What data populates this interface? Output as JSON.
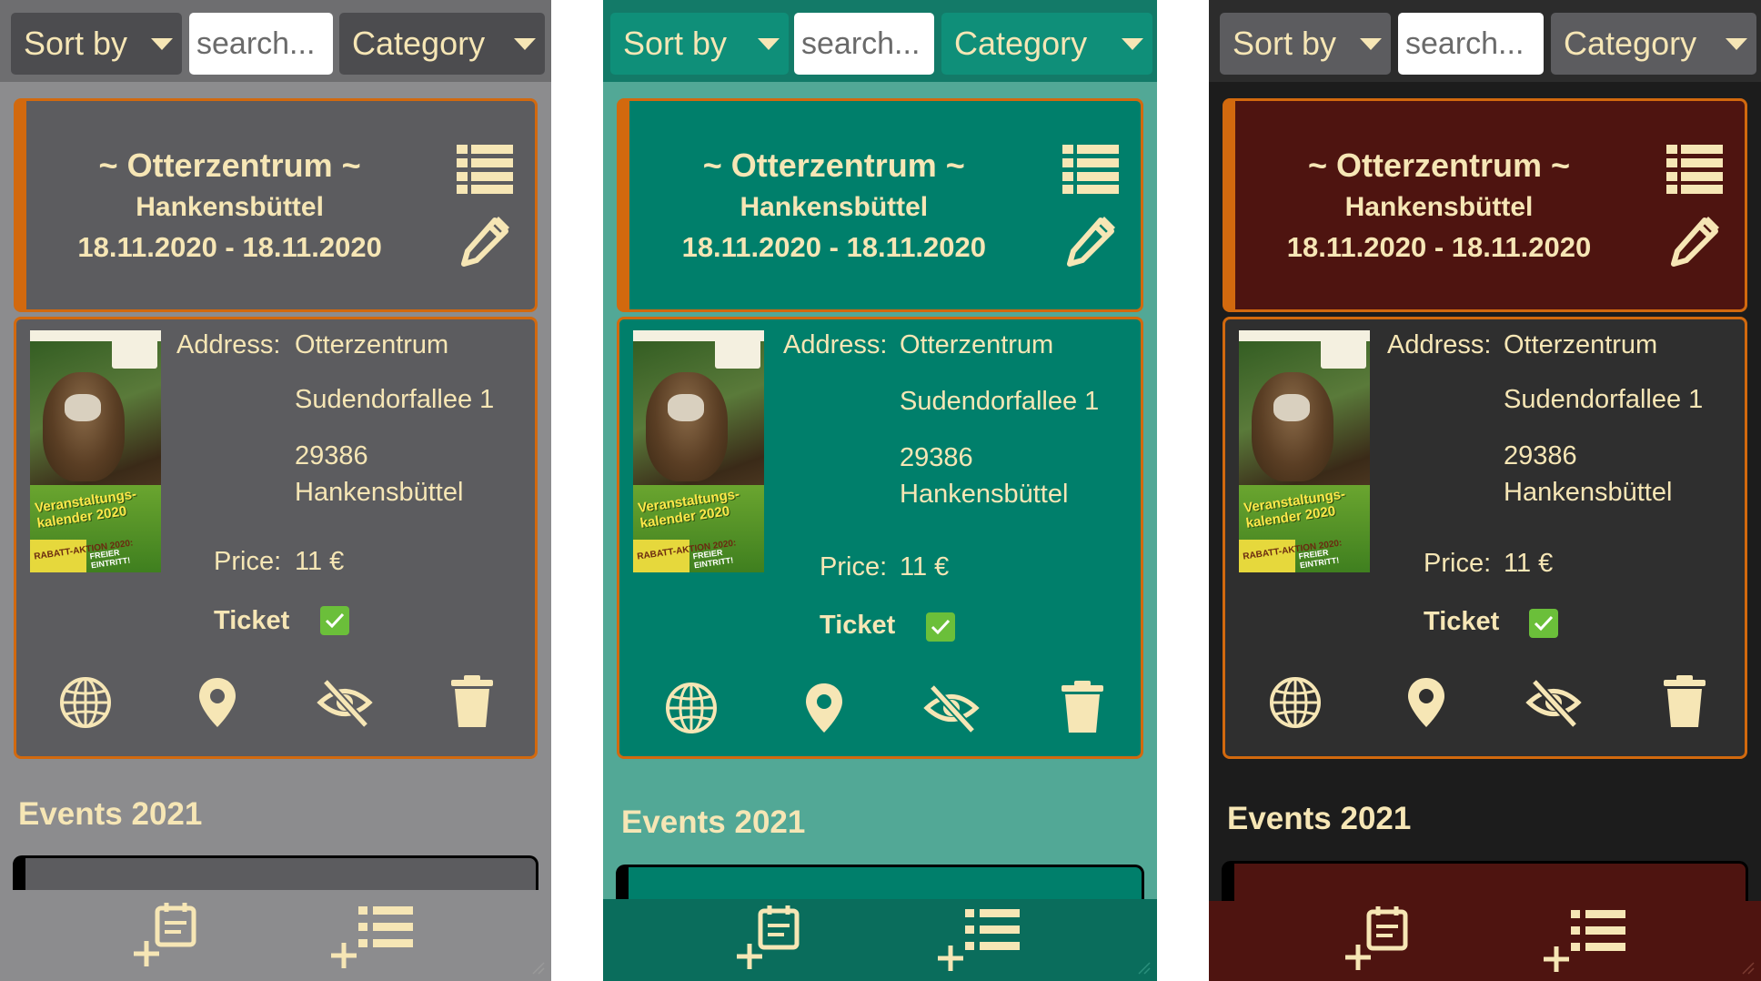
{
  "panels": [
    {
      "theme": "grey",
      "filter": {
        "sort_label": "Sort by",
        "search_placeholder": "search...",
        "category_label": "Category"
      },
      "event": {
        "title": "~ Otterzentrum ~",
        "city": "Hankensbüttel",
        "dates": "18.11.2020 - 18.11.2020",
        "address_label": "Address:",
        "address_line1": "Otterzentrum",
        "address_line2": "Sudendorfallee 1",
        "address_line3": "29386",
        "address_line4": "Hankensbüttel",
        "price_label": "Price:",
        "price_value": "11 €",
        "ticket_label": "Ticket"
      },
      "section_title": "Events 2021"
    },
    {
      "theme": "green",
      "filter": {
        "sort_label": "Sort by",
        "search_placeholder": "search...",
        "category_label": "Category"
      },
      "event": {
        "title": "~ Otterzentrum ~",
        "city": "Hankensbüttel",
        "dates": "18.11.2020 - 18.11.2020",
        "address_label": "Address:",
        "address_line1": "Otterzentrum",
        "address_line2": "Sudendorfallee 1",
        "address_line3": "29386",
        "address_line4": "Hankensbüttel",
        "price_label": "Price:",
        "price_value": "11 €",
        "ticket_label": "Ticket"
      },
      "section_title": "Events 2021"
    },
    {
      "theme": "red",
      "filter": {
        "sort_label": "Sort by",
        "search_placeholder": "search...",
        "category_label": "Category"
      },
      "event": {
        "title": "~ Otterzentrum ~",
        "city": "Hankensbüttel",
        "dates": "18.11.2020 - 18.11.2020",
        "address_label": "Address:",
        "address_line1": "Otterzentrum",
        "address_line2": "Sudendorfallee 1",
        "address_line3": "29386",
        "address_line4": "Hankensbüttel",
        "price_label": "Price:",
        "price_value": "11 €",
        "ticket_label": "Ticket"
      },
      "section_title": "Events 2021"
    }
  ],
  "poster": {
    "headline": "Veranstaltungs-kalender 2020",
    "promo": "RABATT-AKTION 2020:",
    "promo2": "FREIER EINTRITT!"
  },
  "icons": [
    "list-icon",
    "pencil-icon",
    "globe-icon",
    "map-pin-icon",
    "eye-off-icon",
    "trash-icon",
    "add-event-icon",
    "add-list-icon"
  ],
  "colors": {
    "accent_text": "#f6e6b5",
    "border": "#d2690e",
    "grey_card": "#5c5c5f",
    "green_card": "#007f6b",
    "red_card": "#4e1410",
    "ticket_check": "#6bbf3a"
  }
}
